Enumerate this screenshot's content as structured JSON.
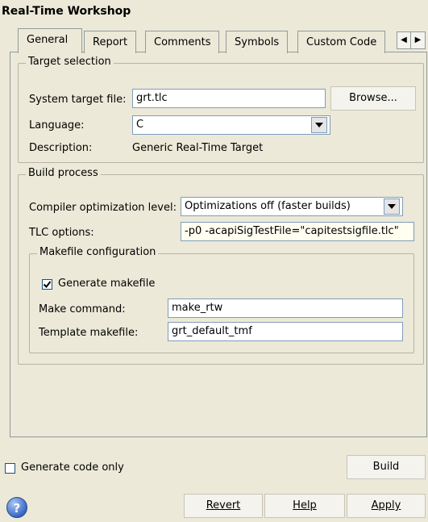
{
  "window": {
    "title": "Real-Time Workshop"
  },
  "tabs": [
    {
      "label": "General",
      "active": true
    },
    {
      "label": "Report"
    },
    {
      "label": "Comments"
    },
    {
      "label": "Symbols"
    },
    {
      "label": "Custom Code"
    }
  ],
  "target_selection": {
    "legend": "Target selection",
    "system_target_file_label": "System target file:",
    "system_target_file_value": "grt.tlc",
    "browse_label": "Browse...",
    "language_label": "Language:",
    "language_value": "C",
    "description_label": "Description:",
    "description_value": "Generic Real-Time Target"
  },
  "build_process": {
    "legend": "Build process",
    "compiler_opt_label": "Compiler optimization level:",
    "compiler_opt_value": "Optimizations off (faster builds)",
    "tlc_options_label": "TLC options:",
    "tlc_options_value": "-p0 -acapiSigTestFile=\"capitestsigfile.tlc\"",
    "makefile": {
      "legend": "Makefile configuration",
      "generate_makefile_label": "Generate makefile",
      "generate_makefile_checked": true,
      "make_command_label": "Make command:",
      "make_command_value": "make_rtw",
      "template_makefile_label": "Template makefile:",
      "template_makefile_value": "grt_default_tmf"
    }
  },
  "footer": {
    "generate_code_only_label": "Generate code only",
    "generate_code_only_checked": false,
    "build_label": "Build",
    "help_icon_glyph": "?",
    "revert_label": "Revert",
    "help_label": "Help",
    "apply_label": "Apply"
  },
  "colors": {
    "panel_bg": "#ece9d8",
    "input_border": "#7f9db9"
  }
}
